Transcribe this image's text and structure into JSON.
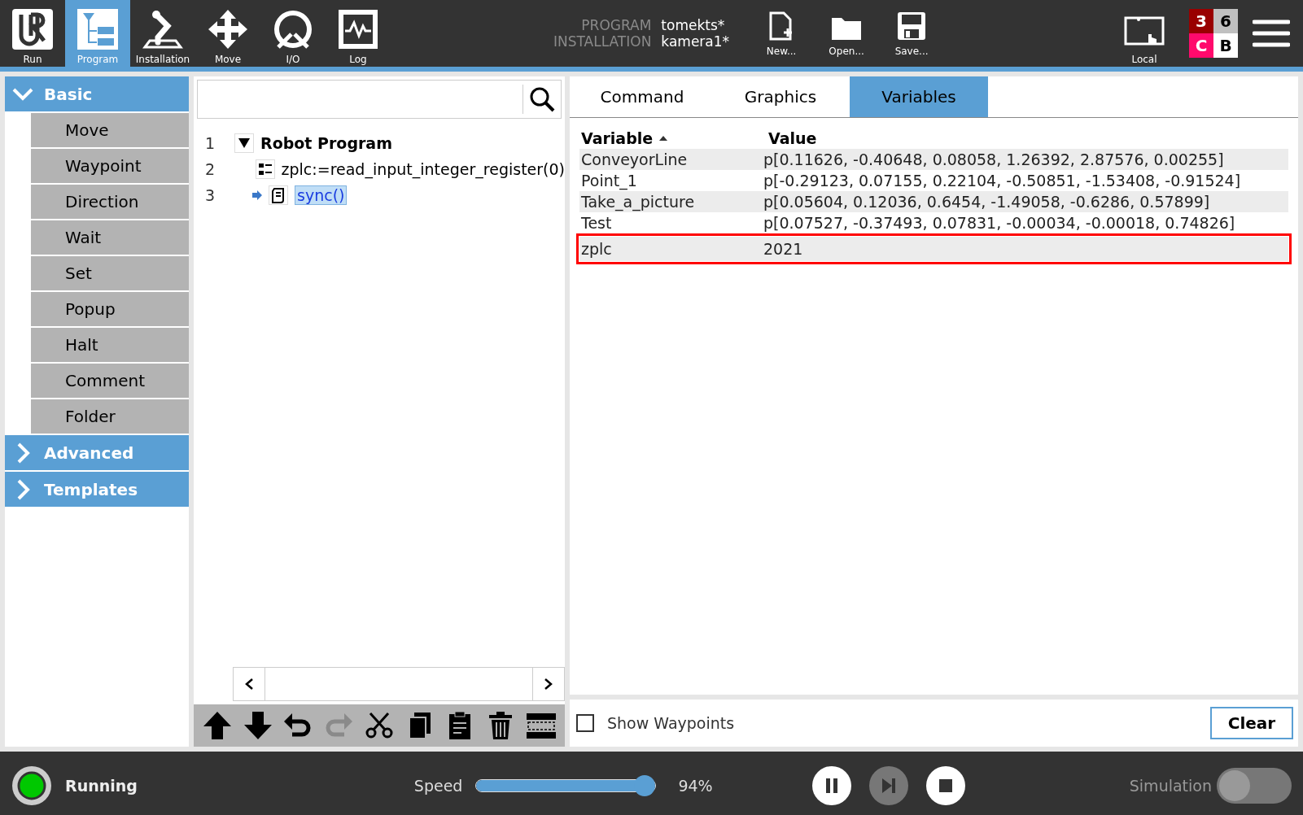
{
  "nav_tabs": [
    {
      "kind": "run",
      "label": "Run",
      "selected": false
    },
    {
      "kind": "program",
      "label": "Program",
      "selected": true
    },
    {
      "kind": "installation",
      "label": "Installation",
      "selected": false
    },
    {
      "kind": "move",
      "label": "Move",
      "selected": false
    },
    {
      "kind": "io",
      "label": "I/O",
      "selected": false
    },
    {
      "kind": "log",
      "label": "Log",
      "selected": false
    }
  ],
  "program_info": [
    {
      "label": "PROGRAM",
      "value": "tomekts*"
    },
    {
      "label": "INSTALLATION",
      "value": "kamera1*"
    }
  ],
  "file_actions": [
    {
      "kind": "new",
      "label": "New..."
    },
    {
      "kind": "open",
      "label": "Open..."
    },
    {
      "kind": "save",
      "label": "Save..."
    }
  ],
  "control_mode": {
    "label": "Local"
  },
  "status_grid": [
    {
      "text": "3",
      "color": "#990000"
    },
    {
      "text": "6",
      "color": "#c0c0c0"
    },
    {
      "text": "C",
      "color": "#ff0a6c"
    },
    {
      "text": "B",
      "color": "#ffffff"
    }
  ],
  "sidebar": {
    "groups": [
      {
        "label": "Basic",
        "expanded": true,
        "items": [
          "Move",
          "Waypoint",
          "Direction",
          "Wait",
          "Set",
          "Popup",
          "Halt",
          "Comment",
          "Folder"
        ]
      },
      {
        "label": "Advanced",
        "expanded": false
      },
      {
        "label": "Templates",
        "expanded": false
      }
    ]
  },
  "tree": {
    "nodes": [
      {
        "line": "1",
        "label": "Robot Program",
        "kind": "root",
        "expanded": true,
        "selected": false,
        "children": [
          {
            "line": "2",
            "label": "zplc:=read_input_integer_register(0)",
            "kind": "assignment",
            "selected": false
          },
          {
            "line": "3",
            "label": "sync()",
            "kind": "script",
            "selected": true
          }
        ]
      }
    ]
  },
  "edit_toolbar": [
    {
      "kind": "up",
      "disabled": false
    },
    {
      "kind": "down",
      "disabled": false
    },
    {
      "kind": "undo",
      "disabled": false
    },
    {
      "kind": "redo",
      "disabled": true
    },
    {
      "kind": "cut",
      "disabled": false
    },
    {
      "kind": "copy",
      "disabled": false
    },
    {
      "kind": "paste",
      "disabled": false
    },
    {
      "kind": "delete",
      "disabled": false
    },
    {
      "kind": "suppress",
      "disabled": false
    }
  ],
  "right_tabs": [
    {
      "label": "Command",
      "selected": false
    },
    {
      "label": "Graphics",
      "selected": false
    },
    {
      "label": "Variables",
      "selected": true
    }
  ],
  "variables": {
    "columns": [
      "Variable",
      "Value"
    ],
    "rows": [
      {
        "name": "ConveyorLine",
        "value": "p[0.11626, -0.40648, 0.08058, 1.26392, 2.87576, 0.00255]",
        "highlighted": false
      },
      {
        "name": "Point_1",
        "value": "p[-0.29123, 0.07155, 0.22104, -0.50851, -1.53408, -0.91524]",
        "highlighted": false
      },
      {
        "name": "Take_a_picture",
        "value": "p[0.05604, 0.12036, 0.6454, -1.49058, -0.6286, 0.57899]",
        "highlighted": false
      },
      {
        "name": "Test",
        "value": "p[0.07527, -0.37493, 0.07831, -0.00034, -0.00018, 0.74826]",
        "highlighted": false
      },
      {
        "name": "zplc",
        "value": "2021",
        "highlighted": true
      }
    ]
  },
  "show_waypoints": {
    "label": "Show Waypoints",
    "checked": false
  },
  "clear_button": "Clear",
  "footer": {
    "status": "Running",
    "speed_label": "Speed",
    "speed": {
      "level": 0.94
    },
    "speed_reading": "94%",
    "playback": [
      {
        "kind": "pause",
        "disabled": false
      },
      {
        "kind": "step",
        "disabled": true
      },
      {
        "kind": "stop",
        "disabled": false
      }
    ],
    "simulation": {
      "label": "Simulation",
      "on": false
    }
  }
}
